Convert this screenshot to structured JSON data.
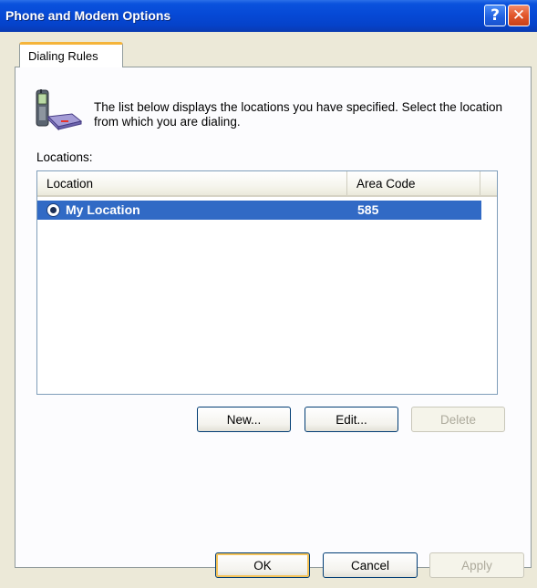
{
  "window": {
    "title": "Phone and Modem Options",
    "help_glyph": "?",
    "close_glyph": "✕"
  },
  "tabs": [
    {
      "label": "Dialing Rules",
      "selected": true
    }
  ],
  "dialing_rules": {
    "description": "The list below displays the locations you have specified. Select the location from which you are dialing.",
    "locations_label": "Locations:",
    "columns": [
      "Location",
      "Area Code"
    ],
    "rows": [
      {
        "location": "My Location",
        "area_code": "585",
        "selected": true,
        "default": true
      }
    ],
    "buttons": {
      "new_label": "New...",
      "edit_label": "Edit...",
      "delete_label": "Delete"
    }
  },
  "footer": {
    "ok_label": "OK",
    "cancel_label": "Cancel",
    "apply_label": "Apply"
  },
  "colors": {
    "titlebar": "#0649d6",
    "selection": "#316ac5",
    "tab_accent": "#f5b43a",
    "face": "#ece9d8"
  },
  "icons": {
    "header": "phone-modem-icon",
    "row": "default-location-radio-icon"
  }
}
